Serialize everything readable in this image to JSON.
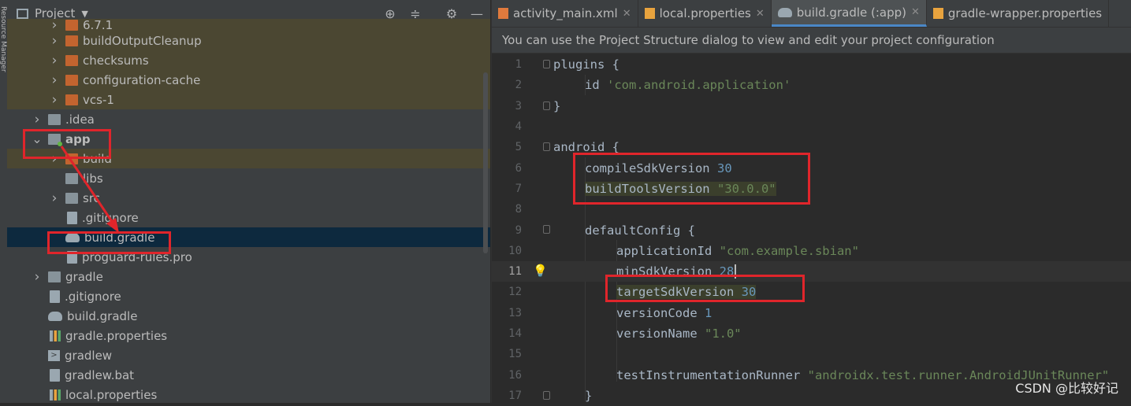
{
  "side_strip": {
    "label": "Resource Manager"
  },
  "project_panel": {
    "title": "Project",
    "tree": [
      {
        "name": "6.7.1",
        "type": "folder-orange",
        "state": "collapsed",
        "highlight": true
      },
      {
        "name": "buildOutputCleanup",
        "type": "folder-orange",
        "state": "collapsed",
        "highlight": true
      },
      {
        "name": "checksums",
        "type": "folder-orange",
        "state": "collapsed",
        "highlight": true
      },
      {
        "name": "configuration-cache",
        "type": "folder-orange",
        "state": "collapsed",
        "highlight": true
      },
      {
        "name": "vcs-1",
        "type": "folder-orange",
        "state": "collapsed",
        "highlight": true
      },
      {
        "name": ".idea",
        "type": "folder-gray",
        "state": "collapsed"
      },
      {
        "name": "app",
        "type": "module",
        "state": "expanded",
        "bold": true
      },
      {
        "name": "build",
        "type": "folder-orange",
        "state": "collapsed",
        "highlight": true
      },
      {
        "name": "libs",
        "type": "folder-gray",
        "state": "none"
      },
      {
        "name": "src",
        "type": "folder-gray",
        "state": "collapsed"
      },
      {
        "name": ".gitignore",
        "type": "file",
        "state": "none"
      },
      {
        "name": "build.gradle",
        "type": "gradle",
        "state": "none",
        "selected": true
      },
      {
        "name": "proguard-rules.pro",
        "type": "file",
        "state": "none"
      },
      {
        "name": "gradle",
        "type": "folder-gray",
        "state": "collapsed"
      },
      {
        "name": ".gitignore",
        "type": "file",
        "state": "none"
      },
      {
        "name": "build.gradle",
        "type": "gradle",
        "state": "none"
      },
      {
        "name": "gradle.properties",
        "type": "properties",
        "state": "none"
      },
      {
        "name": "gradlew",
        "type": "terminal",
        "state": "none"
      },
      {
        "name": "gradlew.bat",
        "type": "file",
        "state": "none"
      },
      {
        "name": "local.properties",
        "type": "properties",
        "state": "none"
      }
    ]
  },
  "editor": {
    "tabs": [
      {
        "label": "activity_main.xml",
        "active": false
      },
      {
        "label": "local.properties",
        "active": false
      },
      {
        "label": "build.gradle (:app)",
        "active": true
      },
      {
        "label": "gradle-wrapper.properties",
        "active": false
      }
    ],
    "banner": "You can use the Project Structure dialog to view and edit your project configuration",
    "current_line": 11,
    "lines": [
      {
        "n": "1",
        "indent": 0,
        "fold": true,
        "parts": [
          {
            "t": "plugins {",
            "c": "txt"
          }
        ]
      },
      {
        "n": "2",
        "indent": 1,
        "parts": [
          {
            "t": "id ",
            "c": "txt"
          },
          {
            "t": "'com.android.application'",
            "c": "str"
          }
        ]
      },
      {
        "n": "3",
        "indent": 0,
        "fold": true,
        "parts": [
          {
            "t": "}",
            "c": "txt"
          }
        ]
      },
      {
        "n": "4",
        "indent": 0,
        "parts": []
      },
      {
        "n": "5",
        "indent": 0,
        "fold": true,
        "parts": [
          {
            "t": "android {",
            "c": "txt"
          }
        ]
      },
      {
        "n": "6",
        "indent": 1,
        "parts": [
          {
            "t": "compileSdkVersion ",
            "c": "txt"
          },
          {
            "t": "30",
            "c": "num"
          }
        ]
      },
      {
        "n": "7",
        "indent": 1,
        "hl": true,
        "parts": [
          {
            "t": "buildToolsVersion ",
            "c": "txt"
          },
          {
            "t": "\"30.0.0\"",
            "c": "str"
          }
        ]
      },
      {
        "n": "8",
        "indent": 0,
        "parts": []
      },
      {
        "n": "9",
        "indent": 1,
        "fold": true,
        "parts": [
          {
            "t": "defaultConfig {",
            "c": "txt"
          }
        ]
      },
      {
        "n": "10",
        "indent": 2,
        "parts": [
          {
            "t": "applicationId ",
            "c": "txt"
          },
          {
            "t": "\"com.example.sbian\"",
            "c": "str"
          }
        ]
      },
      {
        "n": "11",
        "indent": 2,
        "bulb": true,
        "caret": true,
        "parts": [
          {
            "t": "minSdkVersion ",
            "c": "txt"
          },
          {
            "t": "28",
            "c": "num"
          }
        ]
      },
      {
        "n": "12",
        "indent": 2,
        "hl": true,
        "parts": [
          {
            "t": "targetSdkVersion ",
            "c": "txt"
          },
          {
            "t": "30",
            "c": "num"
          }
        ]
      },
      {
        "n": "13",
        "indent": 2,
        "parts": [
          {
            "t": "versionCode ",
            "c": "txt"
          },
          {
            "t": "1",
            "c": "num"
          }
        ]
      },
      {
        "n": "14",
        "indent": 2,
        "parts": [
          {
            "t": "versionName ",
            "c": "txt"
          },
          {
            "t": "\"1.0\"",
            "c": "str"
          }
        ]
      },
      {
        "n": "15",
        "indent": 0,
        "parts": []
      },
      {
        "n": "16",
        "indent": 2,
        "parts": [
          {
            "t": "testInstrumentationRunner ",
            "c": "txt"
          },
          {
            "t": "\"androidx.test.runner.AndroidJUnitRunner\"",
            "c": "str"
          }
        ]
      },
      {
        "n": "17",
        "indent": 1,
        "fold": true,
        "parts": [
          {
            "t": "}",
            "c": "txt"
          }
        ]
      }
    ]
  },
  "watermark": "CSDN @比较好记",
  "colors": {
    "annotation_red": "#e0252b",
    "accent": "#4a88c7",
    "selection": "#0d293e"
  }
}
